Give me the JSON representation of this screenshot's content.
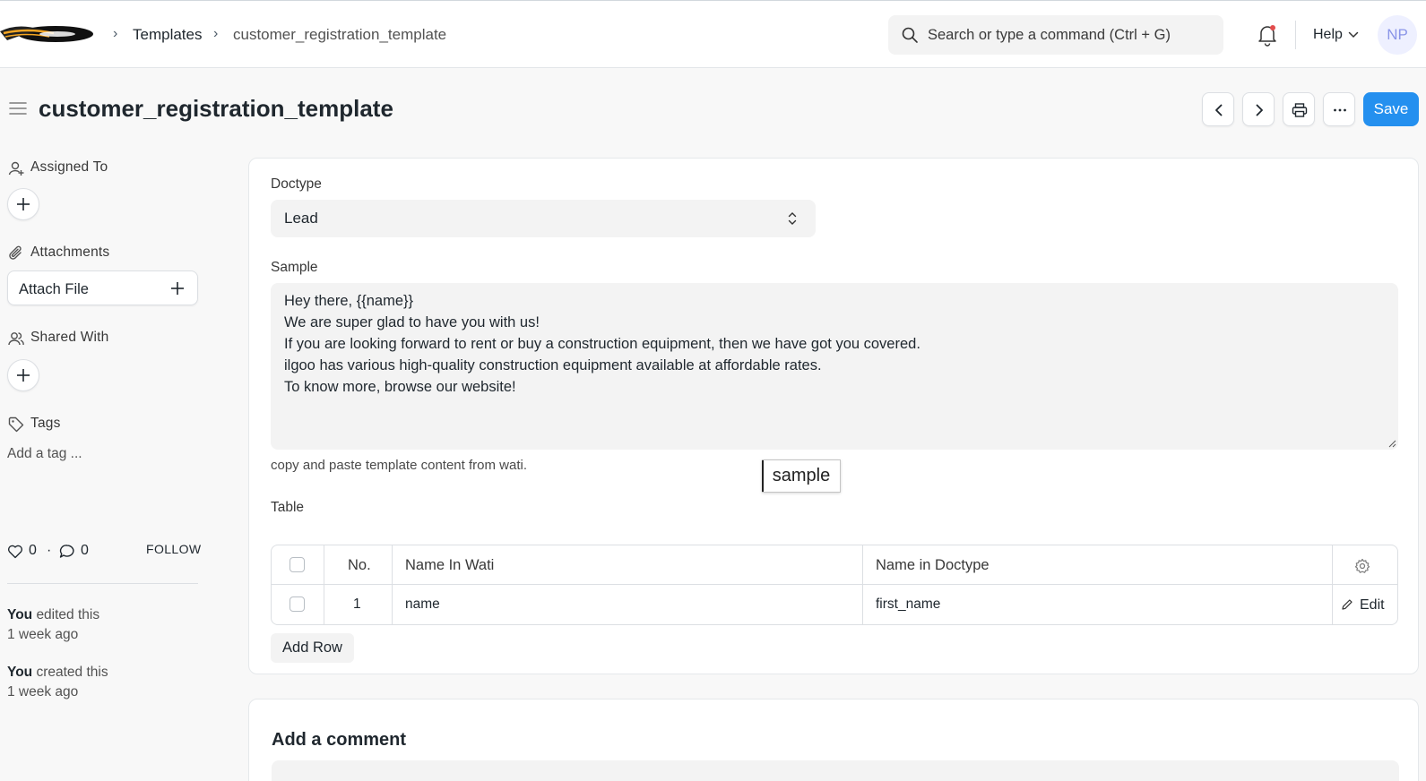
{
  "navbar": {
    "breadcrumbs": [
      "Templates",
      "customer_registration_template"
    ],
    "search_placeholder": "Search or type a command (Ctrl + G)",
    "help_label": "Help",
    "avatar_initials": "NP"
  },
  "page": {
    "title": "customer_registration_template",
    "save_label": "Save"
  },
  "sidebar": {
    "assigned_to_label": "Assigned To",
    "attachments_label": "Attachments",
    "attach_file_label": "Attach File",
    "shared_with_label": "Shared With",
    "tags_label": "Tags",
    "add_tag_label": "Add a tag ...",
    "likes_count": "0",
    "comments_count": "0",
    "follow_label": "FOLLOW",
    "timeline": [
      {
        "actor": "You",
        "action": "edited this",
        "time": "1 week ago"
      },
      {
        "actor": "You",
        "action": "created this",
        "time": "1 week ago"
      }
    ]
  },
  "form": {
    "doctype_label": "Doctype",
    "doctype_value": "Lead",
    "sample_label": "Sample",
    "sample_lines": [
      "Hey there, {{name}}",
      "We are super glad to have you with us!",
      "If you are looking forward to rent or buy a construction equipment, then we have got you covered.",
      "ilgoo has various high-quality construction equipment available at affordable rates.",
      "To know more, browse our website!"
    ],
    "sample_help": "copy and paste template content from wati.",
    "tooltip_text": "sample",
    "table_label": "Table",
    "table": {
      "headers": [
        "No.",
        "Name In Wati",
        "Name in Doctype"
      ],
      "rows": [
        {
          "no": "1",
          "name_in_wati": "name",
          "name_in_doctype": "first_name"
        }
      ],
      "edit_label": "Edit",
      "add_row_label": "Add Row"
    }
  },
  "comments": {
    "title": "Add a comment"
  },
  "colors": {
    "primary": "#2490ef",
    "notification_dot": "#e24c4c",
    "avatar_bg": "#eef0ff",
    "avatar_text": "#8a95e8"
  }
}
